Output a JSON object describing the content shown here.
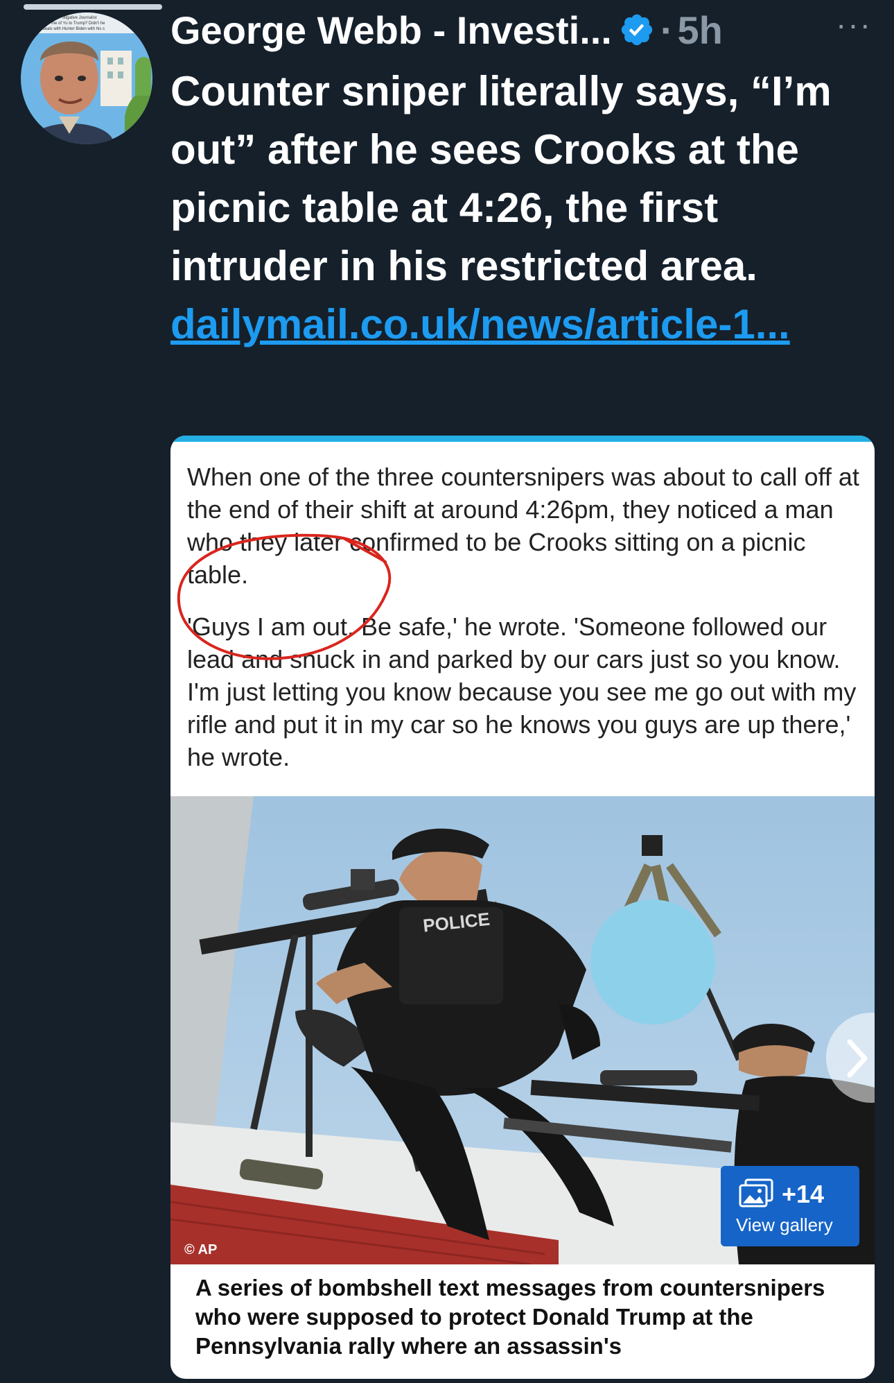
{
  "tweet": {
    "author": "George Webb - Investi...",
    "separator": "·",
    "time": "5h",
    "more": "···",
    "text": "Counter sniper literally says, “I’m out” after he sees Crooks at the picnic table at 4:26, the first intruder in his restricted area.",
    "link": "dailymail.co.uk/news/article-1..."
  },
  "avatar": {
    "banner_lines": [
      "stigative Journalist",
      "me of Yu to Trump? Didn't he",
      "ons deals with Hunter Biden with his s"
    ]
  },
  "card": {
    "paragraph1": "When one of the three countersnipers was about to call off at the end of their shift at around 4:26pm, they noticed a man who they later confirmed to be Crooks sitting on a picnic table.",
    "paragraph2": "'Guys I am out. Be safe,' he wrote. 'Someone followed our lead and snuck in and parked by our cars just so you know. I'm just letting you know because you see me go out with my rifle and put it in my car so he knows you guys are up there,' he wrote.",
    "photo": {
      "vest_label": "POLICE",
      "credit": "© AP"
    },
    "gallery": {
      "count": "+14",
      "label": "View gallery"
    },
    "caption": "A series of bombshell text messages from countersnipers who were supposed to protect Donald Trump at the Pennsylvania rally where an assassin's"
  },
  "icons": {
    "verified": "verified-badge-icon",
    "more": "more-icon",
    "gallery": "gallery-icon",
    "next": "chevron-right-icon"
  },
  "colors": {
    "background": "#15202b",
    "link": "#1d9bf0",
    "secondary_text": "#8b98a5",
    "card_accent": "#24aee4",
    "gallery_button": "#1664c8",
    "annotation_circle": "#d9251d"
  },
  "progress": {
    "fraction": 1.0
  }
}
